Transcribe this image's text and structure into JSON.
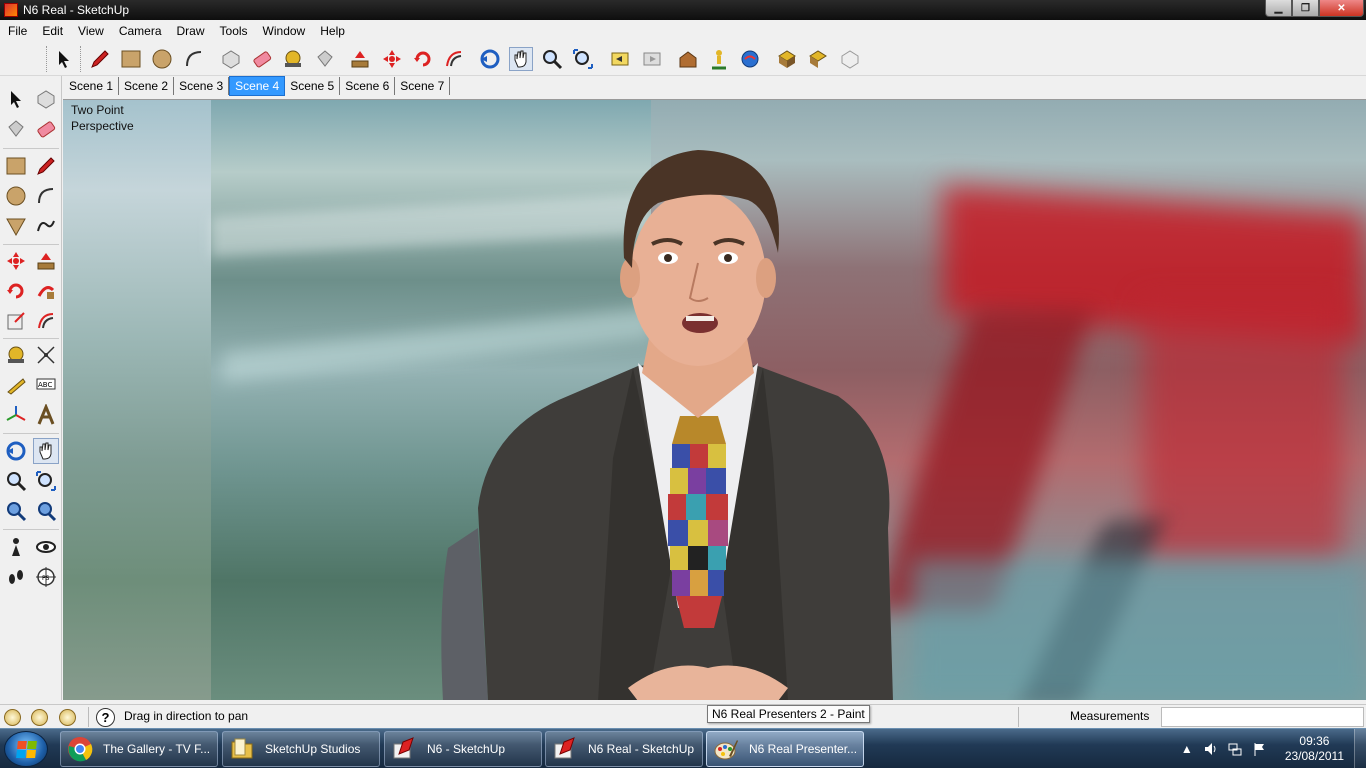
{
  "window": {
    "title": "N6 Real - SketchUp",
    "minimize": "▁",
    "maximize": "❐",
    "close": "✕"
  },
  "menu": [
    "File",
    "Edit",
    "View",
    "Camera",
    "Draw",
    "Tools",
    "Window",
    "Help"
  ],
  "scenes": {
    "tabs": [
      "Scene 1",
      "Scene 2",
      "Scene 3",
      "Scene 4",
      "Scene 5",
      "Scene 6",
      "Scene 7"
    ],
    "active_index": 3
  },
  "viewport": {
    "perspective_label": "Two Point Perspective"
  },
  "status": {
    "help_glyph": "?",
    "message": "Drag in direction to pan",
    "measurements_label": "Measurements",
    "measurements_value": ""
  },
  "tooltip": "N6 Real Presenters 2 - Paint",
  "taskbar": {
    "items": [
      {
        "label": "The Gallery - TV F...",
        "icon": "chrome-icon",
        "active": false
      },
      {
        "label": "SketchUp Studios",
        "icon": "folder-icon",
        "active": false
      },
      {
        "label": "N6 - SketchUp",
        "icon": "sketchup-icon",
        "active": false
      },
      {
        "label": "N6 Real - SketchUp",
        "icon": "sketchup-icon",
        "active": false
      },
      {
        "label": "N6 Real Presenter...",
        "icon": "paint-icon",
        "active": true
      }
    ],
    "tray_arrow": "▲",
    "clock_time": "09:36",
    "clock_date": "23/08/2011"
  },
  "colors": {
    "scene_active": "#3399ff",
    "taskbar": "#16293f",
    "titlebar": "#0e0e0e"
  }
}
